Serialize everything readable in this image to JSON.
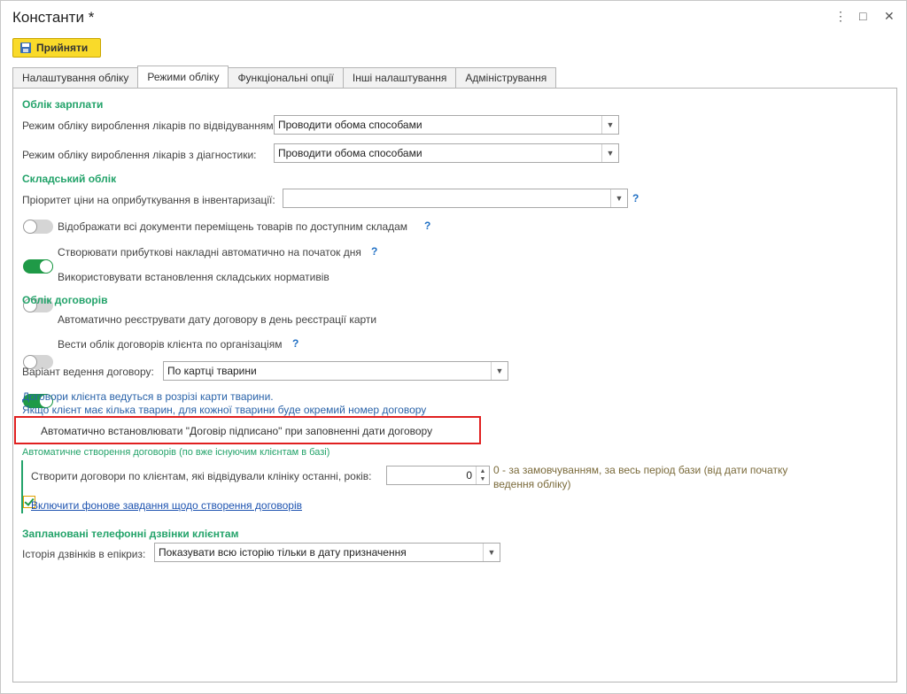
{
  "window": {
    "title": "Константи *",
    "controls": [
      "⋮",
      "□",
      "✕"
    ]
  },
  "toolbar": {
    "accept_label": "Прийняти"
  },
  "tabs": [
    {
      "label": "Налаштування обліку",
      "active": false
    },
    {
      "label": "Режими обліку",
      "active": true
    },
    {
      "label": "Функціональні опції",
      "active": false
    },
    {
      "label": "Інші налаштування",
      "active": false
    },
    {
      "label": "Адміністрування",
      "active": false
    }
  ],
  "salary": {
    "title": "Облік зарплати",
    "visits_label": "Режим обліку вироблення лікарів по відвідуванням:",
    "visits_value": "Проводити обома способами",
    "diag_label": "Режим обліку вироблення лікарів з діагностики:",
    "diag_value": "Проводити обома способами"
  },
  "warehouse": {
    "title": "Складський облік",
    "priority_label": "Пріоритет ціни на оприбуткування в інвентаризації:",
    "priority_value": "",
    "help": "?",
    "toggles": [
      {
        "label": "Відображати всі документи переміщень товарів по доступним складам",
        "on": false,
        "help": "?"
      },
      {
        "label": "Створювати прибуткові накладні автоматично на початок дня",
        "on": true,
        "help": "?"
      },
      {
        "label": "Використовувати встановлення складських нормативів",
        "on": false,
        "help": ""
      }
    ]
  },
  "contracts": {
    "title": "Облік договорів",
    "toggles": [
      {
        "label": "Автоматично реєструвати дату договору в день реєстрації карти",
        "on": false,
        "help": ""
      },
      {
        "label": "Вести облік договорів клієнта по організаціям",
        "on": true,
        "help": "?"
      }
    ],
    "variant_label": "Варіант ведення договору:",
    "variant_value": "По картці тварини",
    "note_line1": "Договори клієнта ведуться в розрізі карти тварини.",
    "note_line2": "Якщо клієнт має кілька тварин, для кожної тварини буде окремий номер договору",
    "auto_signed_label": "Автоматично встановлювати \"Договір підписано\" при заповненні дати договору",
    "auto_signed_checked": true,
    "auto_create_title": "Автоматичне створення договорів (по вже існуючим клієнтам в базі)",
    "create_label": "Створити договори по клієнтам, які відвідували клініку останні, років:",
    "create_value": "0",
    "create_hint_line1": "0 - за замовчуванням, за весь період бази (від дати початку",
    "create_hint_line2": "ведення обліку)",
    "bg_task_link": "Включити фонове завдання щодо створення договорів"
  },
  "calls": {
    "title": "Заплановані телефонні дзвінки клієнтам",
    "history_label": "Історія дзвінків в епікриз:",
    "history_value": "Показувати всю історію тільки в дату призначення"
  },
  "colors": {
    "accent_green": "#23a36a",
    "accept_yellow": "#f9da2a",
    "highlight_red": "#e02020",
    "link_blue": "#1d53b0"
  }
}
